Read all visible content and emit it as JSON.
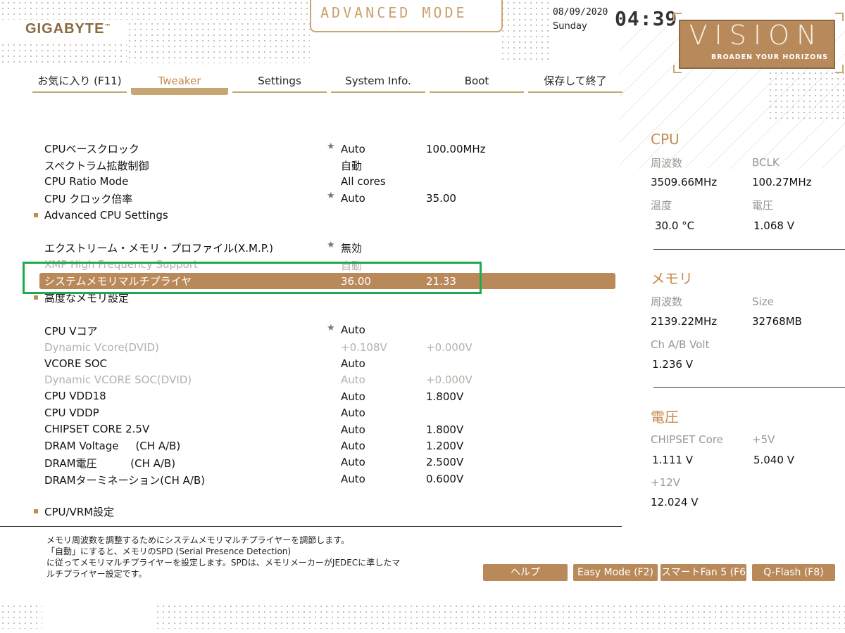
{
  "header": {
    "brand": "GIGABYTE",
    "mode": "ADVANCED MODE",
    "date": "08/09/2020",
    "day": "Sunday",
    "time": "04:39",
    "vision": "VISION",
    "vision_tagline": "BROADEN YOUR HORIZONS"
  },
  "tabs": [
    {
      "label": "お気に入り (F11)"
    },
    {
      "label": "Tweaker",
      "active": true
    },
    {
      "label": "Settings"
    },
    {
      "label": "System Info."
    },
    {
      "label": "Boot"
    },
    {
      "label": "保存して終了"
    }
  ],
  "settings": [
    {
      "name": "CPUベースクロック",
      "starred": true,
      "value": "Auto",
      "value2": "100.00MHz"
    },
    {
      "name": "スペクトラム拡散制御",
      "value": "自動",
      "value2": ""
    },
    {
      "name": "CPU Ratio Mode",
      "value": "All cores",
      "value2": ""
    },
    {
      "name": "CPU クロック倍率",
      "starred": true,
      "value": "Auto",
      "value2": "35.00"
    },
    {
      "name": "Advanced CPU Settings",
      "submenu": true
    },
    {
      "name": "エクストリーム・メモリ・プロファイル(X.M.P.)",
      "starred": true,
      "value": "無効",
      "value2": ""
    },
    {
      "name": "XMP High Frequency Support",
      "dim": true,
      "value": "自動",
      "value2": ""
    },
    {
      "name": "システムメモリマルチプライヤ",
      "selected": true,
      "value": "36.00",
      "value2": "21.33"
    },
    {
      "name": "高度なメモリ設定",
      "submenu": true
    },
    {
      "name": "CPU Vコア",
      "starred": true,
      "value": "Auto",
      "value2": ""
    },
    {
      "name": "Dynamic Vcore(DVID)",
      "dim": true,
      "value": "+0.108V",
      "value2": "+0.000V"
    },
    {
      "name": "VCORE SOC",
      "value": "Auto",
      "value2": ""
    },
    {
      "name": "Dynamic VCORE SOC(DVID)",
      "dim": true,
      "value": "Auto",
      "value2": "+0.000V"
    },
    {
      "name": "CPU VDD18",
      "value": "Auto",
      "value2": "1.800V"
    },
    {
      "name": "CPU VDDP",
      "value": "Auto",
      "value2": ""
    },
    {
      "name": "CHIPSET CORE 2.5V",
      "value": "Auto",
      "value2": "1.800V"
    },
    {
      "name": "DRAM Voltage     (CH A/B)",
      "value": "Auto",
      "value2": "1.200V"
    },
    {
      "name": "DRAM電圧          (CH A/B)",
      "value": "Auto",
      "value2": "2.500V"
    },
    {
      "name": "DRAMターミネーション(CH A/B)",
      "value": "Auto",
      "value2": "0.600V"
    },
    {
      "name": "CPU/VRM設定",
      "submenu": true
    }
  ],
  "panel": {
    "cpu": {
      "title": "CPU",
      "freq_label": "周波数",
      "freq": "3509.66MHz",
      "bclk_label": "BCLK",
      "bclk": "100.27MHz",
      "temp_label": "温度",
      "temp": "30.0 °C",
      "volt_label": "電圧",
      "volt": "1.068 V"
    },
    "memory": {
      "title": "メモリ",
      "freq_label": "周波数",
      "freq": "2139.22MHz",
      "size_label": "Size",
      "size": "32768MB",
      "volt_label": "Ch A/B Volt",
      "volt": "1.236 V"
    },
    "voltage": {
      "title": "電圧",
      "chipset_label": "CHIPSET Core",
      "chipset": "1.111 V",
      "p5_label": "+5V",
      "p5": "5.040 V",
      "p12_label": "+12V",
      "p12": "12.024 V"
    }
  },
  "help": {
    "line1": "メモリ周波数を調整するためにシステムメモリマルチプライヤーを調節します。",
    "line2": "「自動」にすると、メモリのSPD (Serial Presence Detection)",
    "line3": "に従ってメモリマルチプライヤーを設定します。SPDは、メモリメーカーがJEDECに準したマ",
    "line4": "ルチプライヤー設定です。"
  },
  "buttons": {
    "help": "ヘルプ",
    "easy_mode": "Easy Mode (F2)",
    "smart_fan": "スマートFan 5 (F6",
    "qflash": "Q-Flash (F8)"
  },
  "colors": {
    "accent": "#c38b4e",
    "selection": "#b9895a",
    "highlight_box": "#1eaa4f"
  }
}
